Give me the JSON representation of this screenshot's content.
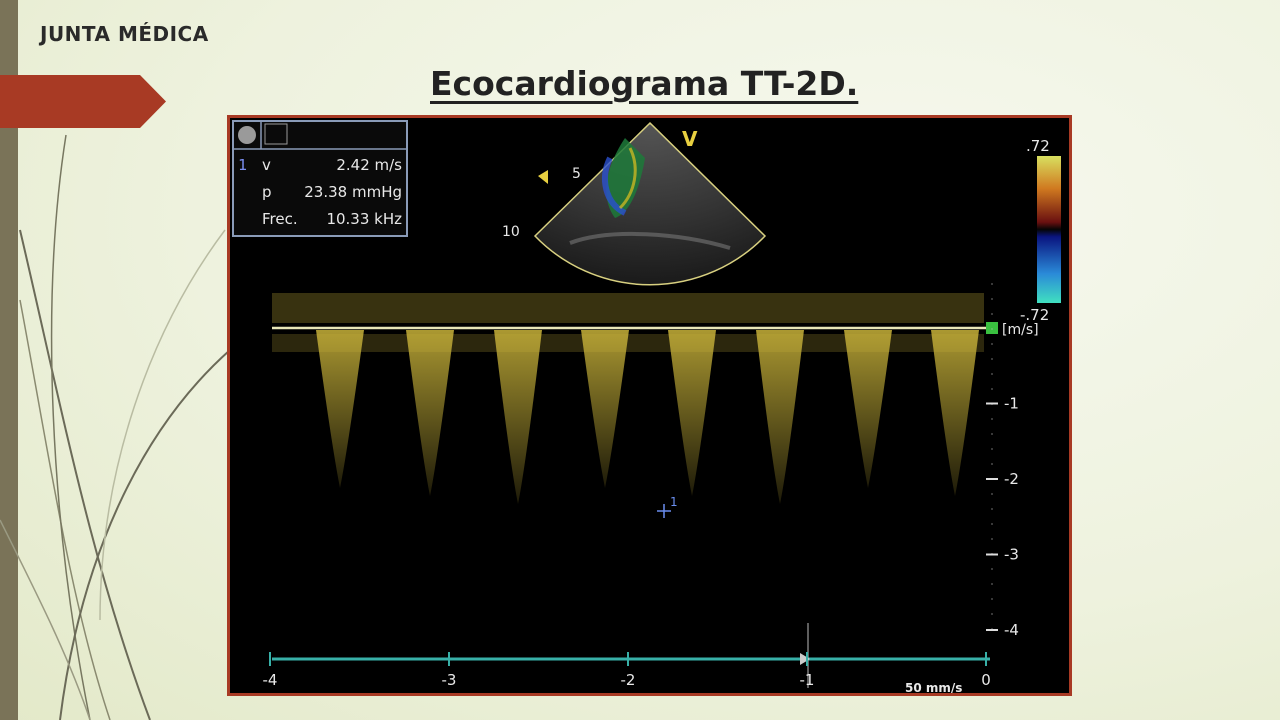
{
  "header": {
    "text": "JUNTA MÉDICA"
  },
  "slide": {
    "title": "Ecocardiograma TT-2D."
  },
  "measurements": {
    "index": "1",
    "rows": [
      {
        "label": "v",
        "value": "2.42 m/s"
      },
      {
        "label": "p",
        "value": "23.38 mmHg"
      },
      {
        "label": "Frec.",
        "value": "10.33 kHz"
      }
    ]
  },
  "sector": {
    "marker": "V",
    "depth_5": "5",
    "depth_10": "10"
  },
  "color_bar": {
    "max": ".72",
    "min": "-.72"
  },
  "velocity_axis": {
    "unit": "[m/s]",
    "ticks": [
      "-1",
      "-2",
      "-3",
      "-4"
    ]
  },
  "time_axis": {
    "ticks": [
      "-4",
      "-3",
      "-2",
      "-1",
      "0"
    ],
    "sweep_speed": "50 mm/s"
  },
  "cursor": {
    "label": "1"
  },
  "colors": {
    "accent_red": "#a83a24",
    "doppler_yellow": "#c9b33a",
    "baseline_teal": "#38b0a8",
    "panel_border": "#8a9bb8"
  }
}
